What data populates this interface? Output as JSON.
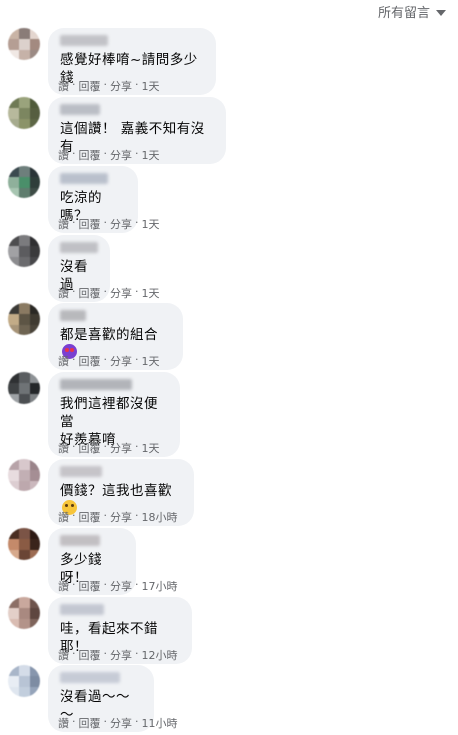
{
  "header": {
    "sort_label": "所有留言"
  },
  "actions": {
    "like": "讚",
    "reply": "回覆",
    "share": "分享",
    "sep": "·"
  },
  "comments": [
    {
      "text": "感覺好棒唷~請問多少錢",
      "time": "1天",
      "emoji": "",
      "avatar": [
        "#c9b4a6",
        "#8a7c78",
        "#e4d6cf",
        "#b59e94",
        "#dcd1cc",
        "#a38a80",
        "#f0e8e4",
        "#c6b2a8",
        "#9b8a84"
      ],
      "name_color": "#b3b3b8"
    },
    {
      "text": "這個讚！ 嘉義不知有沒有",
      "time": "1天",
      "emoji": "",
      "avatar": [
        "#6f7a55",
        "#9aa37c",
        "#4f5a3a",
        "#b7b99c",
        "#7c8660",
        "#565e40",
        "#a6ab8e",
        "#8b9368",
        "#5d6645"
      ],
      "name_color": "#a9adb5"
    },
    {
      "text": "吃涼的嗎？",
      "time": "1天",
      "emoji": "",
      "avatar": [
        "#3b4a4f",
        "#6e7f7c",
        "#2a3437",
        "#8fb09b",
        "#4a8f6a",
        "#2f3e3a",
        "#a7c5b1",
        "#5f7d6e",
        "#3d4c46"
      ],
      "name_color": "#a8b0bf"
    },
    {
      "text": "沒看過",
      "time": "1天",
      "emoji": "",
      "avatar": [
        "#4d4d4f",
        "#7b7b7e",
        "#2f2f31",
        "#a1a1a4",
        "#5c5c5f",
        "#3a3a3c",
        "#8c8c8f",
        "#6b6b6e",
        "#47474a"
      ],
      "name_color": "#b0b0b5"
    },
    {
      "text": "都是喜歡的組合",
      "time": "1天",
      "emoji": "heart-eyes",
      "avatar": [
        "#3b3a36",
        "#8a7a62",
        "#2a2824",
        "#c2ab87",
        "#5d5545",
        "#3f3a31",
        "#a79478",
        "#6e6452",
        "#4a443a"
      ],
      "name_color": "#a6a6aa"
    },
    {
      "text": "我們這裡都沒便當\n好羨慕唷",
      "time": "1天",
      "emoji": "",
      "avatar": [
        "#2f3133",
        "#5a5d60",
        "#8e9296",
        "#3f4244",
        "#6f7376",
        "#24272a",
        "#9ea2a5",
        "#4c4f52",
        "#7d8184"
      ],
      "name_color": "#9ea0a6"
    },
    {
      "text": "價錢？這我也喜歡",
      "time": "18小時",
      "emoji": "grin",
      "avatar": [
        "#b7a3a8",
        "#d8c8cc",
        "#9a848a",
        "#e8dcdf",
        "#c2afb4",
        "#a58e94",
        "#dccdd1",
        "#bda8ad",
        "#cbb8bd"
      ],
      "name_color": "#b8b5ba"
    },
    {
      "text": "多少錢呀！",
      "time": "17小時",
      "emoji": "",
      "avatar": [
        "#4a2e22",
        "#7b5446",
        "#2d1a14",
        "#c48a6a",
        "#8a5b44",
        "#3a241b",
        "#d6a98c",
        "#6a4535",
        "#9c6b52"
      ],
      "name_color": "#b3aeb2"
    },
    {
      "text": "哇，看起來不錯耶！",
      "time": "12小時",
      "emoji": "",
      "avatar": [
        "#8c6f66",
        "#c9a89d",
        "#6e544c",
        "#e3cfc8",
        "#a98980",
        "#5e463f",
        "#d9bcb2",
        "#b39389",
        "#7f645b"
      ],
      "name_color": "#b5b9c6"
    },
    {
      "text": "沒看過～～～",
      "time": "11小時",
      "emoji": "",
      "avatar": [
        "#a9b6c9",
        "#d4dce8",
        "#8796ad",
        "#e8edf4",
        "#b8c4d5",
        "#7d8ca3",
        "#dfe6ef",
        "#c2cedd",
        "#95a4ba"
      ],
      "name_color": "#b9bfcc"
    }
  ]
}
